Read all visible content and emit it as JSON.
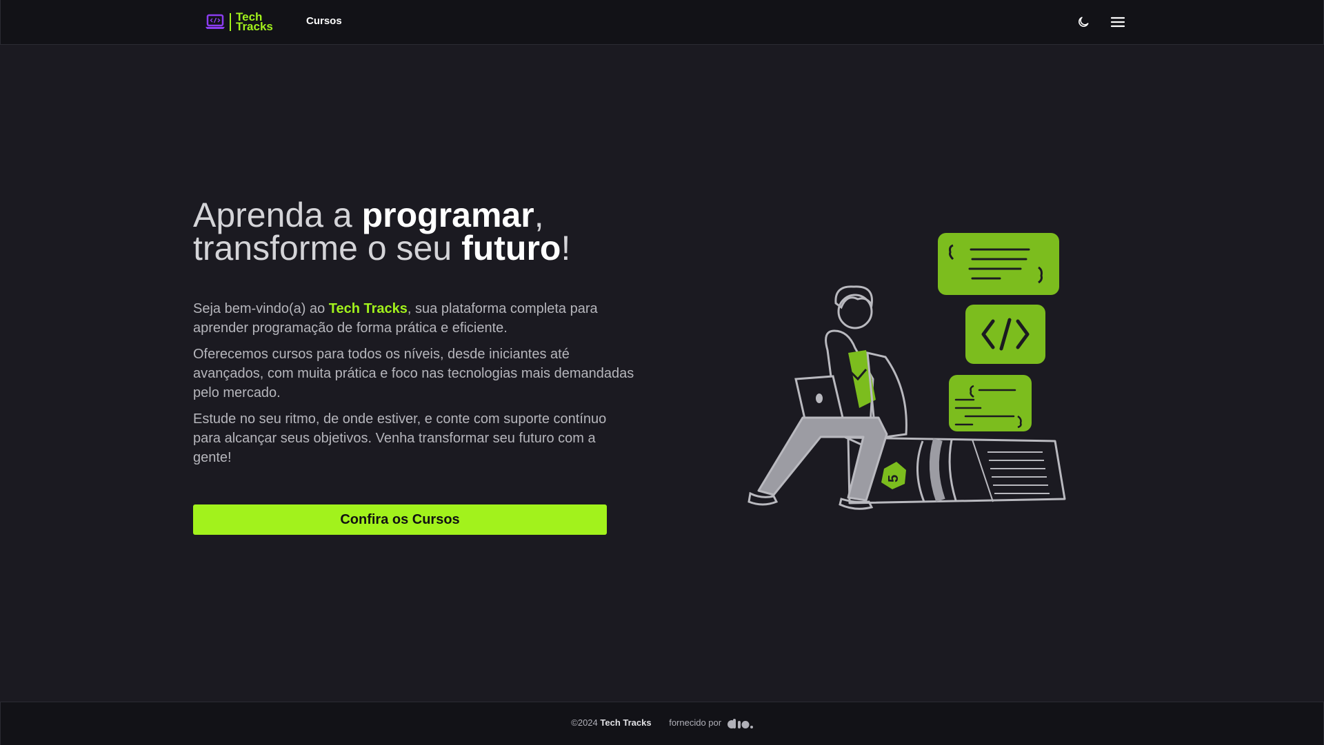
{
  "header": {
    "logo_line1": "Tech",
    "logo_line2": "Tracks",
    "nav_courses": "Cursos",
    "theme_icon": "moon-icon",
    "menu_icon": "hamburger-menu-icon"
  },
  "hero": {
    "headline_part1": "Aprenda a ",
    "headline_bold1": "programar",
    "headline_part2": ",",
    "headline_part3": "transforme o seu ",
    "headline_bold2": "futuro",
    "headline_part4": "!",
    "intro_prefix": "Seja bem-vindo(a) ao ",
    "intro_brand": "Tech Tracks",
    "intro_suffix": ", sua plataforma completa para aprender programação de forma prática e eficiente.",
    "paragraph2": "Oferecemos cursos para todos os níveis, desde iniciantes até avançados, com muita prática e foco nas tecnologias mais demandadas pelo mercado.",
    "paragraph3": "Estude no seu ritmo, de onde estiver, e conte com suporte contínuo para alcançar seus objetivos. Venha transformar seu futuro com a gente!",
    "cta_label": "Confira os Cursos"
  },
  "footer": {
    "copyright_prefix": "©2024 ",
    "copyright_brand": "Tech Tracks",
    "powered_by": "fornecido por",
    "powered_logo": "dio"
  },
  "colors": {
    "accent": "#a2f21c",
    "background": "#1b1a21",
    "bar": "#121217",
    "illustration_green": "#7cbd1e"
  }
}
